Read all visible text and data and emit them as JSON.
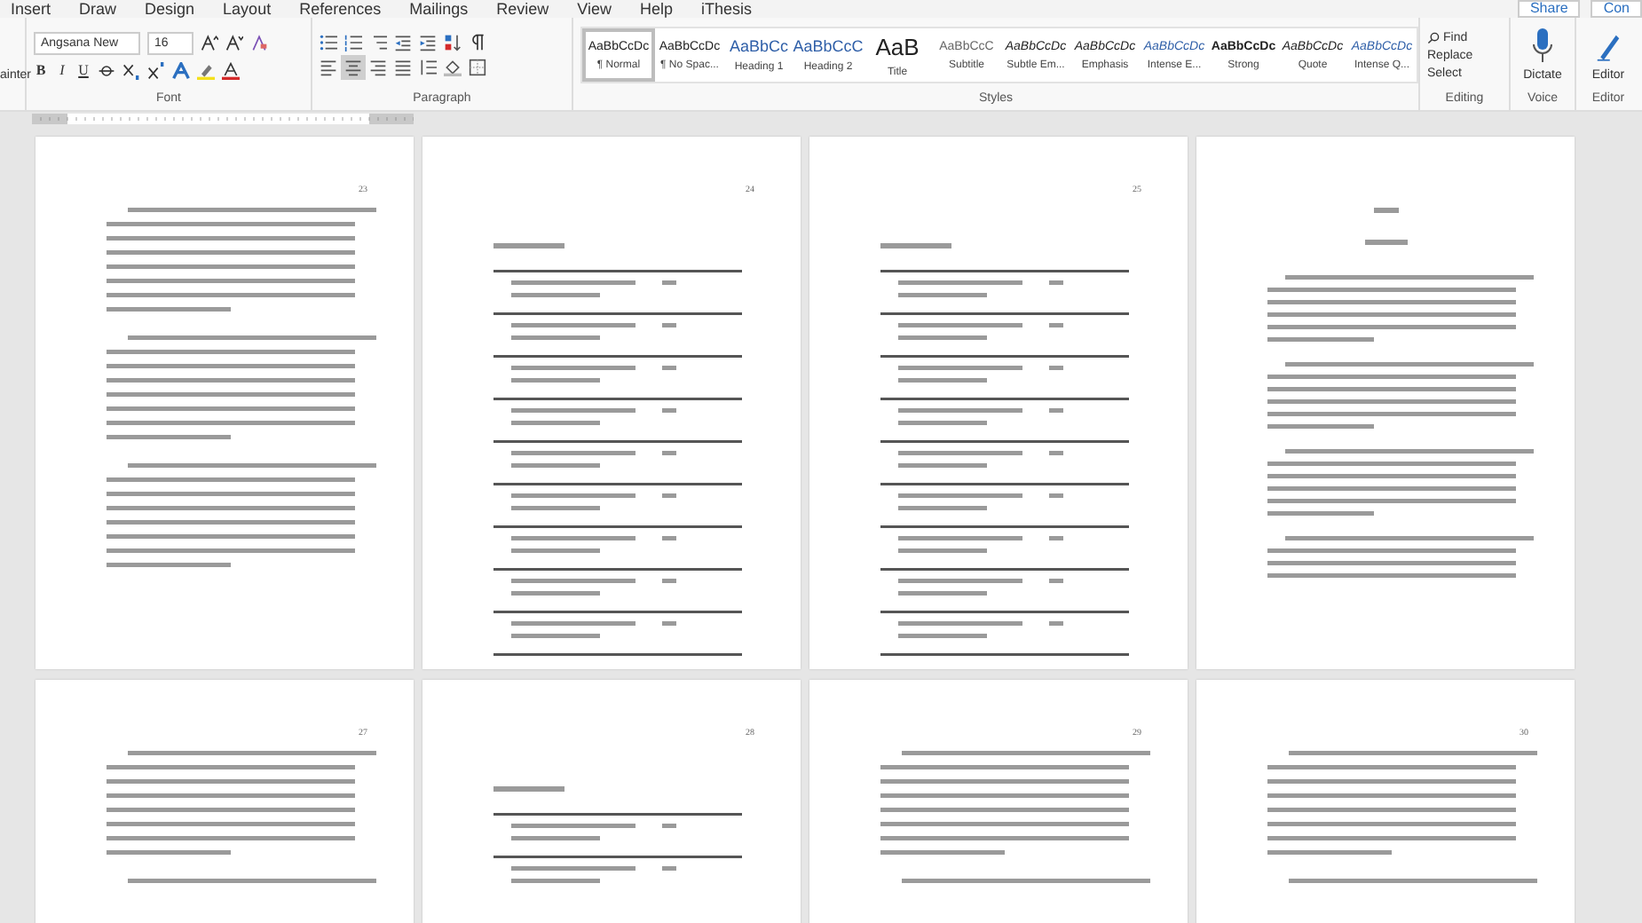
{
  "menu_tabs": [
    "Insert",
    "Draw",
    "Design",
    "Layout",
    "References",
    "Mailings",
    "Review",
    "View",
    "Help",
    "iThesis"
  ],
  "share_button": "Share",
  "comments_button": "Con",
  "clipboard": {
    "label": "ainter"
  },
  "font": {
    "name": "Angsana New",
    "size": "16",
    "bold": "B",
    "italic": "I",
    "underline": "U",
    "group_label": "Font"
  },
  "paragraph": {
    "group_label": "Paragraph",
    "alignments": [
      {
        "selected": false
      },
      {
        "selected": true
      },
      {
        "selected": false
      },
      {
        "selected": false
      }
    ]
  },
  "styles": {
    "group_label": "Styles",
    "items": [
      {
        "preview": "AaBbCcDc",
        "label": "¶ Normal",
        "kind": "normal",
        "selected": true
      },
      {
        "preview": "AaBbCcDc",
        "label": "¶ No Spac...",
        "kind": "normal",
        "selected": false
      },
      {
        "preview": "AaBbCc",
        "label": "Heading 1",
        "kind": "heading",
        "selected": false
      },
      {
        "preview": "AaBbCcC",
        "label": "Heading 2",
        "kind": "heading",
        "selected": false
      },
      {
        "preview": "AaB",
        "label": "Title",
        "kind": "title",
        "selected": false
      },
      {
        "preview": "AaBbCcC",
        "label": "Subtitle",
        "kind": "subtle",
        "selected": false
      },
      {
        "preview": "AaBbCcDc",
        "label": "Subtle Em...",
        "kind": "italic",
        "selected": false
      },
      {
        "preview": "AaBbCcDc",
        "label": "Emphasis",
        "kind": "italic",
        "selected": false
      },
      {
        "preview": "AaBbCcDc",
        "label": "Intense E...",
        "kind": "intense",
        "selected": false
      },
      {
        "preview": "AaBbCcDc",
        "label": "Strong",
        "kind": "strong",
        "selected": false
      },
      {
        "preview": "AaBbCcDc",
        "label": "Quote",
        "kind": "italic",
        "selected": false
      },
      {
        "preview": "AaBbCcDc",
        "label": "Intense Q...",
        "kind": "intense",
        "selected": false
      }
    ]
  },
  "editing": {
    "group_label": "Editing",
    "find": "Find",
    "replace": "Replace",
    "select": "Select"
  },
  "voice": {
    "group_label": "Voice",
    "dictate": "Dictate"
  },
  "editor": {
    "group_label": "Editor",
    "button": "Editor"
  },
  "pages": [
    {
      "number": "23",
      "kind": "text"
    },
    {
      "number": "24",
      "kind": "table"
    },
    {
      "number": "25",
      "kind": "table"
    },
    {
      "kind": "chapter"
    },
    {
      "number": "27",
      "kind": "text"
    },
    {
      "number": "28",
      "kind": "table"
    },
    {
      "number": "29",
      "kind": "text"
    },
    {
      "number": "30",
      "kind": "text"
    }
  ]
}
